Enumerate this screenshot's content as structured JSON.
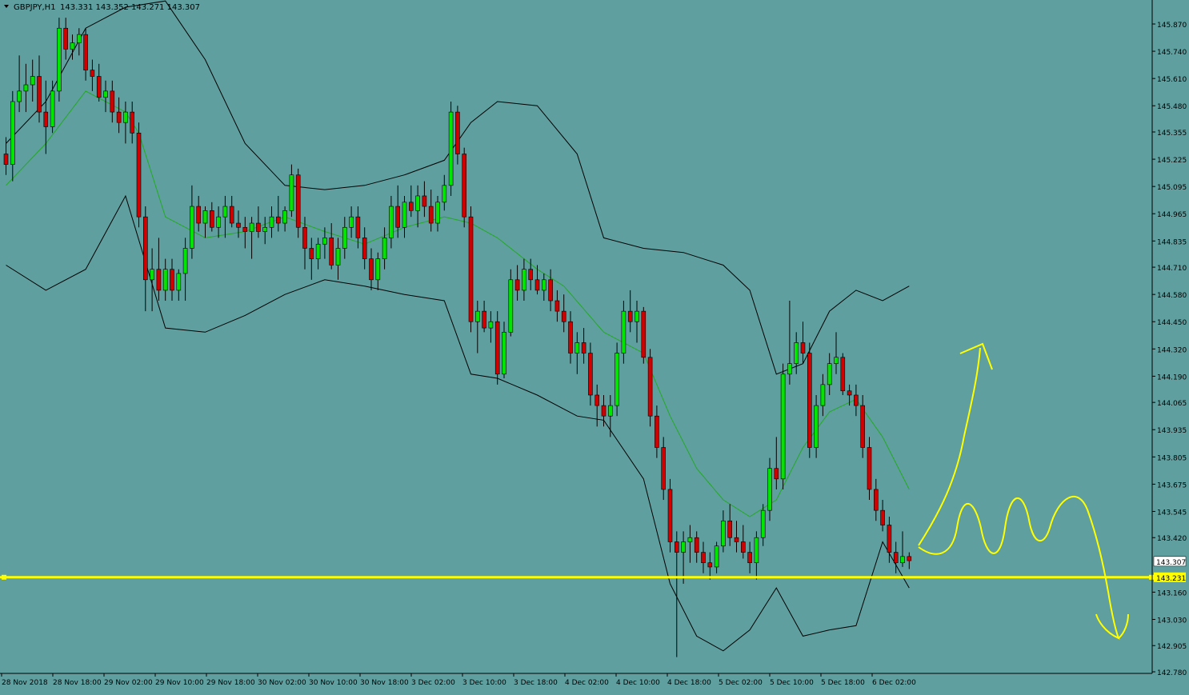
{
  "header": {
    "symbol": "GBPJPY,H1",
    "ohlc": "143.331 143.352 143.271 143.307"
  },
  "colors": {
    "background": "#609f9f",
    "bull": "#00e600",
    "bear": "#d00000",
    "wick": "#000000",
    "band": "#000000",
    "ma": "#22aa22",
    "level": "#ffff00",
    "annotation": "#ffff00",
    "grid": "#7cb3b3"
  },
  "chart_data": {
    "type": "candlestick",
    "price_axis": {
      "ylim": [
        142.78,
        145.95
      ],
      "ticks": [
        "145.870",
        "145.740",
        "145.610",
        "145.480",
        "145.355",
        "145.225",
        "145.095",
        "144.965",
        "144.835",
        "144.710",
        "144.580",
        "144.450",
        "144.320",
        "144.190",
        "144.065",
        "143.935",
        "143.805",
        "143.675",
        "143.545",
        "143.420",
        "143.160",
        "143.030",
        "142.905",
        "142.780"
      ],
      "current_price_label": "143.307",
      "level_label": "143.231"
    },
    "time_axis": {
      "labels": [
        "28 Nov 2018",
        "28 Nov 18:00",
        "29 Nov 02:00",
        "29 Nov 10:00",
        "29 Nov 18:00",
        "30 Nov 02:00",
        "30 Nov 10:00",
        "30 Nov 18:00",
        "3 Dec 02:00",
        "3 Dec 10:00",
        "3 Dec 18:00",
        "4 Dec 02:00",
        "4 Dec 10:00",
        "4 Dec 18:00",
        "5 Dec 02:00",
        "5 Dec 10:00",
        "5 Dec 18:00",
        "6 Dec 02:00"
      ]
    },
    "horizontal_level": 143.231,
    "candles": [
      [
        0,
        145.25,
        145.33,
        145.15,
        145.2
      ],
      [
        1,
        145.2,
        145.55,
        145.12,
        145.5
      ],
      [
        2,
        145.5,
        145.72,
        145.45,
        145.55
      ],
      [
        3,
        145.55,
        145.68,
        145.45,
        145.58
      ],
      [
        4,
        145.58,
        145.7,
        145.5,
        145.62
      ],
      [
        5,
        145.62,
        145.72,
        145.4,
        145.45
      ],
      [
        6,
        145.45,
        145.6,
        145.25,
        145.38
      ],
      [
        7,
        145.38,
        145.6,
        145.35,
        145.55
      ],
      [
        8,
        145.55,
        145.9,
        145.5,
        145.85
      ],
      [
        9,
        145.85,
        145.9,
        145.7,
        145.75
      ],
      [
        10,
        145.75,
        145.82,
        145.7,
        145.78
      ],
      [
        11,
        145.78,
        145.85,
        145.72,
        145.82
      ],
      [
        12,
        145.82,
        145.85,
        145.6,
        145.65
      ],
      [
        13,
        145.65,
        145.7,
        145.55,
        145.62
      ],
      [
        14,
        145.62,
        145.68,
        145.5,
        145.52
      ],
      [
        15,
        145.52,
        145.6,
        145.45,
        145.55
      ],
      [
        16,
        145.55,
        145.6,
        145.4,
        145.45
      ],
      [
        17,
        145.45,
        145.52,
        145.35,
        145.4
      ],
      [
        18,
        145.4,
        145.5,
        145.3,
        145.45
      ],
      [
        19,
        145.45,
        145.5,
        145.3,
        145.35
      ],
      [
        20,
        145.35,
        145.4,
        144.9,
        144.95
      ],
      [
        21,
        144.95,
        145.0,
        144.5,
        144.65
      ],
      [
        22,
        144.65,
        144.8,
        144.5,
        144.7
      ],
      [
        23,
        144.7,
        144.85,
        144.55,
        144.6
      ],
      [
        24,
        144.6,
        144.75,
        144.55,
        144.7
      ],
      [
        25,
        144.7,
        144.75,
        144.55,
        144.6
      ],
      [
        26,
        144.6,
        144.7,
        144.55,
        144.68
      ],
      [
        27,
        144.68,
        144.85,
        144.55,
        144.8
      ],
      [
        28,
        144.8,
        145.1,
        144.75,
        145.0
      ],
      [
        29,
        145.0,
        145.05,
        144.88,
        144.92
      ],
      [
        30,
        144.92,
        145.0,
        144.85,
        144.98
      ],
      [
        31,
        144.98,
        145.02,
        144.88,
        144.9
      ],
      [
        32,
        144.9,
        145.0,
        144.85,
        144.95
      ],
      [
        33,
        144.95,
        145.05,
        144.85,
        145.0
      ],
      [
        34,
        145.0,
        145.05,
        144.9,
        144.92
      ],
      [
        35,
        144.92,
        144.98,
        144.85,
        144.9
      ],
      [
        36,
        144.9,
        144.95,
        144.8,
        144.88
      ],
      [
        37,
        144.88,
        144.95,
        144.75,
        144.92
      ],
      [
        38,
        144.92,
        145.0,
        144.85,
        144.88
      ],
      [
        39,
        144.88,
        144.95,
        144.82,
        144.9
      ],
      [
        40,
        144.9,
        145.0,
        144.85,
        144.95
      ],
      [
        41,
        144.95,
        145.05,
        144.88,
        144.92
      ],
      [
        42,
        144.92,
        145.0,
        144.88,
        144.98
      ],
      [
        43,
        144.98,
        145.2,
        144.95,
        145.15
      ],
      [
        44,
        145.15,
        145.18,
        144.85,
        144.9
      ],
      [
        45,
        144.9,
        144.95,
        144.7,
        144.8
      ],
      [
        46,
        144.8,
        144.85,
        144.65,
        144.75
      ],
      [
        47,
        144.75,
        144.85,
        144.7,
        144.82
      ],
      [
        48,
        144.82,
        144.9,
        144.75,
        144.85
      ],
      [
        49,
        144.85,
        144.92,
        144.7,
        144.72
      ],
      [
        50,
        144.72,
        144.85,
        144.65,
        144.8
      ],
      [
        51,
        144.8,
        144.95,
        144.75,
        144.9
      ],
      [
        52,
        144.9,
        145.0,
        144.85,
        144.95
      ],
      [
        53,
        144.95,
        145.0,
        144.8,
        144.85
      ],
      [
        54,
        144.85,
        144.9,
        144.7,
        144.75
      ],
      [
        55,
        144.75,
        144.8,
        144.6,
        144.65
      ],
      [
        56,
        144.65,
        144.78,
        144.6,
        144.75
      ],
      [
        57,
        144.75,
        144.9,
        144.7,
        144.85
      ],
      [
        58,
        144.85,
        145.05,
        144.8,
        145.0
      ],
      [
        59,
        145.0,
        145.1,
        144.85,
        144.9
      ],
      [
        60,
        144.9,
        145.05,
        144.85,
        145.02
      ],
      [
        61,
        145.02,
        145.1,
        144.95,
        144.98
      ],
      [
        62,
        144.98,
        145.1,
        144.9,
        145.05
      ],
      [
        63,
        145.05,
        145.12,
        144.95,
        145.0
      ],
      [
        64,
        145.0,
        145.08,
        144.88,
        144.92
      ],
      [
        65,
        144.92,
        145.05,
        144.88,
        145.02
      ],
      [
        66,
        145.02,
        145.15,
        144.98,
        145.1
      ],
      [
        67,
        145.1,
        145.5,
        145.05,
        145.45
      ],
      [
        68,
        145.45,
        145.48,
        145.2,
        145.25
      ],
      [
        69,
        145.25,
        145.28,
        144.9,
        144.95
      ],
      [
        70,
        144.95,
        145.0,
        144.4,
        144.45
      ],
      [
        71,
        144.45,
        144.55,
        144.3,
        144.5
      ],
      [
        72,
        144.5,
        144.55,
        144.4,
        144.42
      ],
      [
        73,
        144.42,
        144.5,
        144.35,
        144.45
      ],
      [
        74,
        144.45,
        144.5,
        144.15,
        144.2
      ],
      [
        75,
        144.2,
        144.45,
        144.18,
        144.4
      ],
      [
        76,
        144.4,
        144.7,
        144.38,
        144.65
      ],
      [
        77,
        144.65,
        144.72,
        144.55,
        144.6
      ],
      [
        78,
        144.6,
        144.75,
        144.55,
        144.7
      ],
      [
        79,
        144.7,
        144.75,
        144.6,
        144.65
      ],
      [
        80,
        144.65,
        144.72,
        144.58,
        144.6
      ],
      [
        81,
        144.6,
        144.68,
        144.55,
        144.65
      ],
      [
        82,
        144.65,
        144.7,
        144.5,
        144.55
      ],
      [
        83,
        144.55,
        144.6,
        144.45,
        144.5
      ],
      [
        84,
        144.5,
        144.58,
        144.4,
        144.45
      ],
      [
        85,
        144.45,
        144.5,
        144.25,
        144.3
      ],
      [
        86,
        144.3,
        144.4,
        144.2,
        144.35
      ],
      [
        87,
        144.35,
        144.42,
        144.25,
        144.3
      ],
      [
        88,
        144.3,
        144.35,
        144.05,
        144.1
      ],
      [
        89,
        144.1,
        144.15,
        143.95,
        144.05
      ],
      [
        90,
        144.05,
        144.1,
        143.95,
        144.0
      ],
      [
        91,
        144.0,
        144.1,
        143.9,
        144.05
      ],
      [
        92,
        144.05,
        144.35,
        144.0,
        144.3
      ],
      [
        93,
        144.3,
        144.55,
        144.25,
        144.5
      ],
      [
        94,
        144.5,
        144.6,
        144.4,
        144.45
      ],
      [
        95,
        144.45,
        144.55,
        144.35,
        144.5
      ],
      [
        96,
        144.5,
        144.52,
        144.25,
        144.28
      ],
      [
        97,
        144.28,
        144.32,
        143.95,
        144.0
      ],
      [
        98,
        144.0,
        144.05,
        143.8,
        143.85
      ],
      [
        99,
        143.85,
        143.9,
        143.6,
        143.65
      ],
      [
        100,
        143.65,
        143.7,
        143.35,
        143.4
      ],
      [
        101,
        143.4,
        143.45,
        142.85,
        143.35
      ],
      [
        102,
        143.35,
        143.45,
        143.2,
        143.4
      ],
      [
        103,
        143.4,
        143.48,
        143.3,
        143.42
      ],
      [
        104,
        143.42,
        143.45,
        143.3,
        143.35
      ],
      [
        105,
        143.35,
        143.4,
        143.25,
        143.3
      ],
      [
        106,
        143.3,
        143.35,
        143.22,
        143.28
      ],
      [
        107,
        143.28,
        143.4,
        143.25,
        143.38
      ],
      [
        108,
        143.38,
        143.55,
        143.35,
        143.5
      ],
      [
        109,
        143.5,
        143.58,
        143.38,
        143.42
      ],
      [
        110,
        143.42,
        143.5,
        143.35,
        143.4
      ],
      [
        111,
        143.4,
        143.48,
        143.32,
        143.35
      ],
      [
        112,
        143.35,
        143.4,
        143.25,
        143.3
      ],
      [
        113,
        143.3,
        143.45,
        143.22,
        143.42
      ],
      [
        114,
        143.42,
        143.58,
        143.38,
        143.55
      ],
      [
        115,
        143.55,
        143.8,
        143.5,
        143.75
      ],
      [
        116,
        143.75,
        143.9,
        143.65,
        143.7
      ],
      [
        117,
        143.7,
        144.25,
        143.65,
        144.2
      ],
      [
        118,
        144.2,
        144.55,
        144.15,
        144.25
      ],
      [
        119,
        144.25,
        144.4,
        144.2,
        144.35
      ],
      [
        120,
        144.35,
        144.45,
        144.25,
        144.3
      ],
      [
        121,
        144.3,
        144.35,
        143.8,
        143.85
      ],
      [
        122,
        143.85,
        144.1,
        143.8,
        144.05
      ],
      [
        123,
        144.05,
        144.2,
        144.0,
        144.15
      ],
      [
        124,
        144.15,
        144.3,
        144.1,
        144.25
      ],
      [
        125,
        144.25,
        144.4,
        144.2,
        144.28
      ],
      [
        126,
        144.28,
        144.3,
        144.1,
        144.12
      ],
      [
        127,
        144.12,
        144.15,
        144.05,
        144.1
      ],
      [
        128,
        144.1,
        144.15,
        144.0,
        144.05
      ],
      [
        129,
        144.05,
        144.1,
        143.8,
        143.85
      ],
      [
        130,
        143.85,
        143.9,
        143.6,
        143.65
      ],
      [
        131,
        143.65,
        143.7,
        143.5,
        143.55
      ],
      [
        132,
        143.55,
        143.6,
        143.45,
        143.48
      ],
      [
        133,
        143.48,
        143.52,
        143.3,
        143.35
      ],
      [
        134,
        143.35,
        143.4,
        143.25,
        143.3
      ],
      [
        135,
        143.3,
        143.45,
        143.28,
        143.33
      ],
      [
        136,
        143.33,
        143.35,
        143.27,
        143.31
      ]
    ],
    "upper_band": [
      [
        0,
        145.3
      ],
      [
        6,
        145.5
      ],
      [
        12,
        145.85
      ],
      [
        18,
        145.95
      ],
      [
        24,
        145.98
      ],
      [
        30,
        145.7
      ],
      [
        36,
        145.3
      ],
      [
        42,
        145.1
      ],
      [
        48,
        145.08
      ],
      [
        54,
        145.1
      ],
      [
        60,
        145.15
      ],
      [
        66,
        145.22
      ],
      [
        70,
        145.4
      ],
      [
        74,
        145.5
      ],
      [
        80,
        145.48
      ],
      [
        86,
        145.25
      ],
      [
        90,
        144.85
      ],
      [
        96,
        144.8
      ],
      [
        102,
        144.78
      ],
      [
        108,
        144.72
      ],
      [
        112,
        144.6
      ],
      [
        116,
        144.2
      ],
      [
        120,
        144.25
      ],
      [
        124,
        144.5
      ],
      [
        128,
        144.6
      ],
      [
        132,
        144.55
      ],
      [
        136,
        144.62
      ]
    ],
    "lower_band": [
      [
        0,
        144.72
      ],
      [
        6,
        144.6
      ],
      [
        12,
        144.7
      ],
      [
        18,
        145.05
      ],
      [
        24,
        144.42
      ],
      [
        30,
        144.4
      ],
      [
        36,
        144.48
      ],
      [
        42,
        144.58
      ],
      [
        48,
        144.65
      ],
      [
        54,
        144.62
      ],
      [
        60,
        144.58
      ],
      [
        66,
        144.55
      ],
      [
        70,
        144.2
      ],
      [
        74,
        144.18
      ],
      [
        80,
        144.1
      ],
      [
        86,
        144.0
      ],
      [
        90,
        143.98
      ],
      [
        96,
        143.7
      ],
      [
        100,
        143.2
      ],
      [
        104,
        142.95
      ],
      [
        108,
        142.88
      ],
      [
        112,
        142.98
      ],
      [
        116,
        143.18
      ],
      [
        120,
        142.95
      ],
      [
        124,
        142.98
      ],
      [
        128,
        143.0
      ],
      [
        132,
        143.4
      ],
      [
        136,
        143.18
      ]
    ],
    "ma": [
      [
        0,
        145.1
      ],
      [
        6,
        145.3
      ],
      [
        12,
        145.55
      ],
      [
        18,
        145.45
      ],
      [
        20,
        145.35
      ],
      [
        24,
        144.95
      ],
      [
        30,
        144.85
      ],
      [
        36,
        144.88
      ],
      [
        42,
        144.95
      ],
      [
        48,
        144.88
      ],
      [
        54,
        144.82
      ],
      [
        60,
        144.9
      ],
      [
        66,
        144.95
      ],
      [
        70,
        144.92
      ],
      [
        74,
        144.85
      ],
      [
        80,
        144.7
      ],
      [
        84,
        144.62
      ],
      [
        90,
        144.4
      ],
      [
        96,
        144.3
      ],
      [
        100,
        144.0
      ],
      [
        104,
        143.75
      ],
      [
        108,
        143.6
      ],
      [
        112,
        143.52
      ],
      [
        116,
        143.6
      ],
      [
        120,
        143.85
      ],
      [
        124,
        144.02
      ],
      [
        128,
        144.08
      ],
      [
        132,
        143.9
      ],
      [
        136,
        143.65
      ]
    ]
  }
}
